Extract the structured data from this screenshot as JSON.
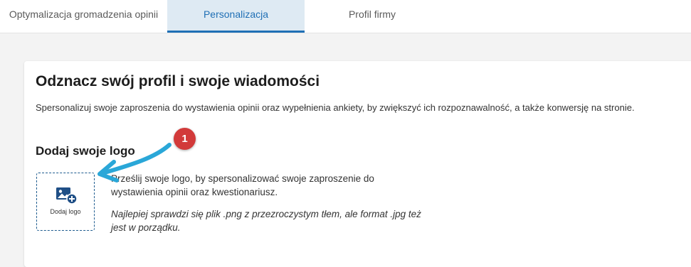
{
  "tabs": [
    {
      "label": "Optymalizacja gromadzenia opinii",
      "active": false
    },
    {
      "label": "Personalizacja",
      "active": true
    },
    {
      "label": "Profil firmy",
      "active": false
    }
  ],
  "card": {
    "title": "Odznacz swój profil i swoje wiadomości",
    "description": "Spersonalizuj swoje zaproszenia do wystawienia opinii oraz wypełnienia ankiety, by zwiększyć ich rozpoznawalność, a także konwersję na stronie.",
    "logo_section": {
      "title": "Dodaj swoje logo",
      "upload_button_label": "Dodaj logo",
      "upload_icon": "add-image-icon",
      "instruction": "Prześlij swoje logo, by spersonalizować swoje zaproszenie do wystawienia opinii oraz kwestionariusz.",
      "hint": "Najlepiej sprawdzi się plik .png z przezroczystym tłem, ale format .jpg też jest w porządku."
    }
  },
  "annotation": {
    "badge_number": "1",
    "badge_color": "#d23a3a",
    "arrow_color": "#2aa7d8"
  },
  "colors": {
    "accent": "#1f6fb5",
    "active_tab_bg": "#deeaf3",
    "page_bg": "#f3f3f3"
  }
}
